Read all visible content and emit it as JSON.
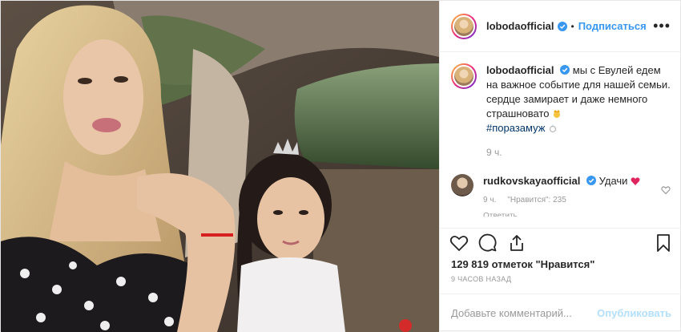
{
  "post": {
    "username": "lobodaofficial",
    "separator": "•",
    "follow_label": "Подписаться",
    "more_label": "•••",
    "caption_text": "мы с Евулей едем на важное событие для нашей семьи. сердце замирает и даже немного страшновато",
    "hashtag": "#поразамуж",
    "caption_time": "9 ч.",
    "comment": {
      "username": "rudkovskayaofficial",
      "text": "Удачи",
      "time": "9 ч.",
      "likes": "\"Нравится\": 235",
      "reply_label": "Ответить"
    },
    "likes_count": "129 819 отметок \"Нравится\"",
    "time_ago": "9 ЧАСОВ НАЗАД",
    "comment_placeholder": "Добавьте комментарий...",
    "publish_label": "Опубликовать"
  },
  "colors": {
    "link": "#3897f0",
    "hashtag": "#003569",
    "publish_disabled": "#b2dffc",
    "heart": "#ed4956"
  }
}
